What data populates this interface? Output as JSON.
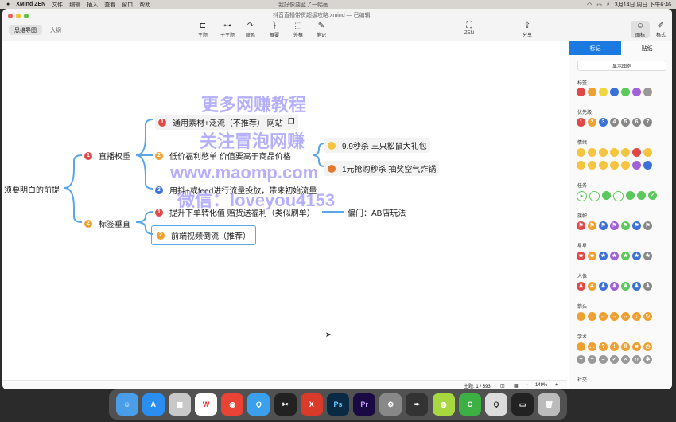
{
  "menubar": {
    "app_name": "XMind ZEN",
    "menus": [
      "文件",
      "编辑",
      "插入",
      "查看",
      "窗口",
      "帮助"
    ],
    "notice": "我好像要蓝了一幅画",
    "clock": "3月14日 周日 下午6:46"
  },
  "window": {
    "doc_title": "抖音直播带货超级攻略.xmind — 已编辑",
    "view_tabs": [
      "思维导图",
      "大纲"
    ],
    "toolbar": [
      {
        "label": "主题",
        "icon": "topic-icon"
      },
      {
        "label": "子主题",
        "icon": "subtopic-icon"
      },
      {
        "label": "联系",
        "icon": "relationship-icon"
      },
      {
        "label": "概要",
        "icon": "summary-icon"
      },
      {
        "label": "外框",
        "icon": "boundary-icon"
      },
      {
        "label": "笔记",
        "icon": "note-icon"
      }
    ],
    "zen_label": "ZEN",
    "share_label": "分享",
    "right_icons": [
      "图标",
      "格式"
    ]
  },
  "mindmap": {
    "root": "须要明白的前提",
    "branches": [
      {
        "num": "1",
        "label": "直播权重"
      },
      {
        "num": "2",
        "label": "标签垂直"
      }
    ],
    "sub1": [
      {
        "num": "1",
        "label": "通用素材+泛流（不推荐）   网站",
        "color": "red"
      },
      {
        "num": "2",
        "label": "低价福利憋单  价值要高于商品价格",
        "color": "orange"
      },
      {
        "num": "3",
        "label": "用抖+或feed进行流量投放，带来初始流量",
        "color": "blue"
      }
    ],
    "sub1b": [
      "9.9秒杀    三只松鼠大礼包",
      "1元抢购秒杀  抽奖空气炸锅"
    ],
    "sub2": [
      {
        "num": "1",
        "label": "提升下单转化值 赔货送福利（类似刷单）",
        "color": "red"
      },
      {
        "num": "2",
        "label": "前端视频倒流（推荐）",
        "color": "orange"
      }
    ],
    "sub2a_child": "偏门：AB店玩法"
  },
  "watermark": [
    "更多网赚教程",
    "关注冒泡网赚",
    "www.maomp.com",
    "微信：loveyou4153"
  ],
  "panel": {
    "tabs": [
      "标记",
      "贴纸"
    ],
    "show_legend": "显示图例",
    "sections": [
      "标签",
      "优先级",
      "情绪",
      "任务",
      "旗帜",
      "星星",
      "人像",
      "箭头",
      "学术",
      "社交"
    ]
  },
  "statusbar": {
    "topic_count": "主题: 1 / 593",
    "zoom": "149%"
  },
  "dock": [
    "Finder",
    "App Store",
    "Launchpad",
    "WPS",
    "Chrome",
    "QQ",
    "Final Cut",
    "XMind",
    "Ps",
    "Pr",
    "Settings",
    "Pen",
    "Lime",
    "Camtasia",
    "QuickTime",
    "Terminal",
    "Trash"
  ],
  "colors": {
    "accent": "#1a7ae0",
    "label_colors": [
      "#e04848",
      "#f0a030",
      "#f2d440",
      "#3a70d8",
      "#5ac85a",
      "#a060d8",
      "#999999"
    ]
  }
}
